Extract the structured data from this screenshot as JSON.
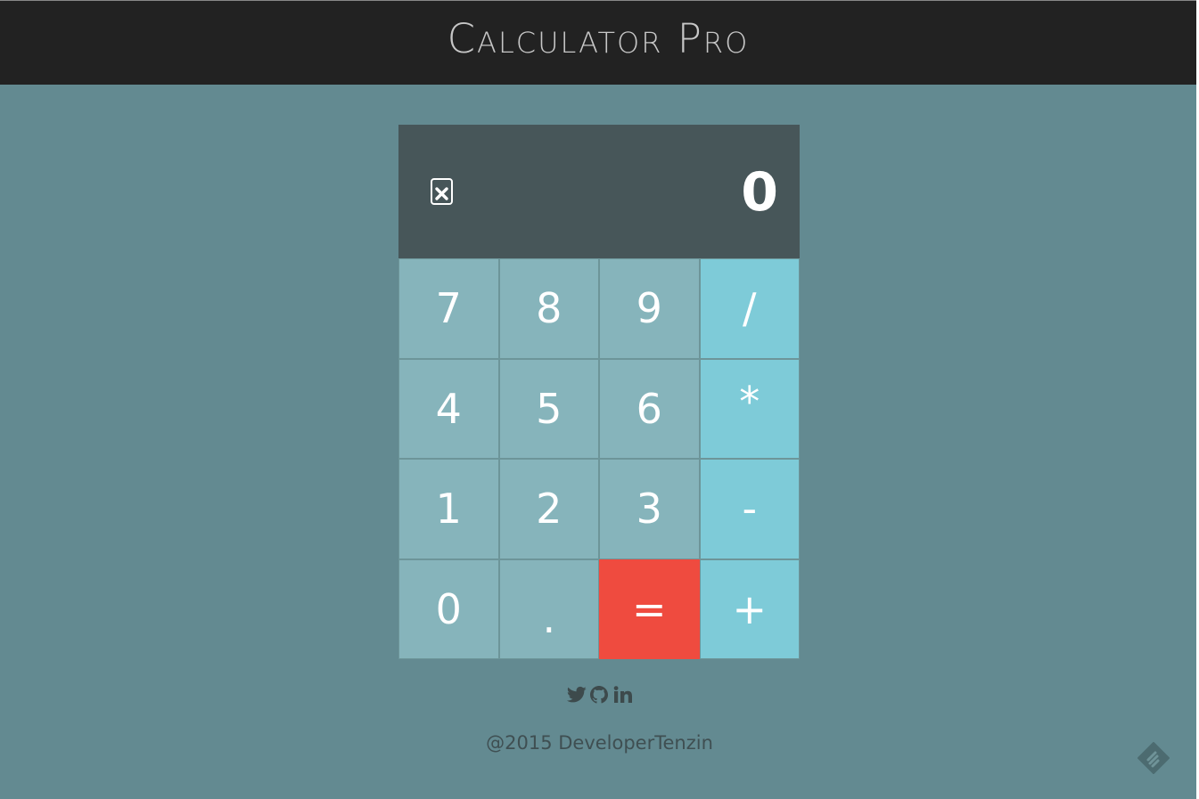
{
  "header": {
    "title": "Calculator Pro"
  },
  "display": {
    "clear_icon": "close-square-icon",
    "value": "0"
  },
  "keypad": {
    "keys": [
      {
        "label": "7",
        "kind": "num"
      },
      {
        "label": "8",
        "kind": "num"
      },
      {
        "label": "9",
        "kind": "num"
      },
      {
        "label": "/",
        "kind": "op"
      },
      {
        "label": "4",
        "kind": "num"
      },
      {
        "label": "5",
        "kind": "num"
      },
      {
        "label": "6",
        "kind": "num"
      },
      {
        "label": "*",
        "kind": "op"
      },
      {
        "label": "1",
        "kind": "num"
      },
      {
        "label": "2",
        "kind": "num"
      },
      {
        "label": "3",
        "kind": "num"
      },
      {
        "label": "-",
        "kind": "op"
      },
      {
        "label": "0",
        "kind": "num"
      },
      {
        "label": ".",
        "kind": "num"
      },
      {
        "label": "=",
        "kind": "eq"
      },
      {
        "label": "+",
        "kind": "op"
      }
    ]
  },
  "social": {
    "icons": [
      "twitter-icon",
      "github-icon",
      "linkedin-icon"
    ]
  },
  "footer": {
    "copyright": "@2015 DeveloperTenzin"
  },
  "colors": {
    "page_bg": "#638a91",
    "header_bg": "#222222",
    "display_bg": "#475659",
    "number_key": "#86b4bb",
    "operator_key": "#7ecbd8",
    "equals_key": "#ef4b3f"
  }
}
